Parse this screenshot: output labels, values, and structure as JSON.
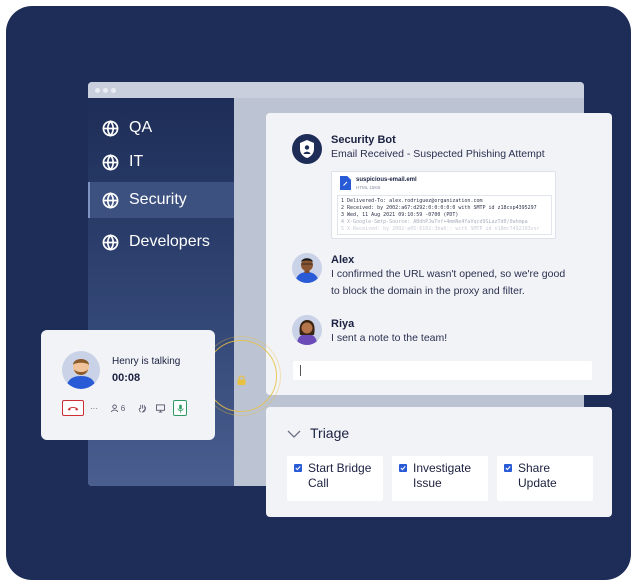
{
  "sidebar": {
    "items": [
      {
        "label": "QA",
        "icon": "globe-icon"
      },
      {
        "label": "IT",
        "icon": "globe-icon"
      },
      {
        "label": "Security",
        "icon": "globe-icon",
        "active": true
      },
      {
        "label": "Developers",
        "icon": "globe-icon"
      }
    ]
  },
  "chat": {
    "messages": [
      {
        "author": "Security Bot",
        "text": "Email Received - Suspected Phishing Attempt"
      },
      {
        "author": "Alex",
        "text_lines": [
          "I confirmed the URL wasn't opened, so we're good",
          "to block the domain in the proxy and filter."
        ]
      },
      {
        "author": "Riya",
        "text": "I sent a note to the team!"
      }
    ],
    "attachment": {
      "filename": "suspicious-email.eml",
      "filetype": "HTML 15KB",
      "lines": [
        "1  Delivered-To: alex.rodriguez@organization.com",
        "2  Received: by 2002:a67:d292:0:0:0:0:0 with SMTP id z18csp4395297",
        "3        Wed, 11 Aug 2021 09:10:59 -0700 (PDT)",
        "4  X-Google-Smtp-Source: ABdhPJwTnf+4mmNe4YaVqcd9SLazTd0/0ahmpa",
        "5  X-Received: by 2002:a05:6102:3ba6:: with SMTP id n18mr7492193vsr"
      ]
    },
    "composer_value": ""
  },
  "triage": {
    "title": "Triage",
    "tasks": [
      {
        "label_lines": [
          "Start Bridge",
          "Call"
        ],
        "checked": true
      },
      {
        "label_lines": [
          "Investigate",
          "Issue"
        ],
        "checked": true
      },
      {
        "label_lines": [
          "Share",
          "Update"
        ],
        "checked": true
      }
    ]
  },
  "call": {
    "status": "Henry is talking",
    "duration": "00:08",
    "participants": "6",
    "more": "···"
  },
  "colors": {
    "background": "#1d2d57",
    "accent_blue": "#2a5bd7",
    "hangup_red": "#cc2e36",
    "mic_green": "#2c9c63",
    "lock_gold": "#e8c13f"
  }
}
